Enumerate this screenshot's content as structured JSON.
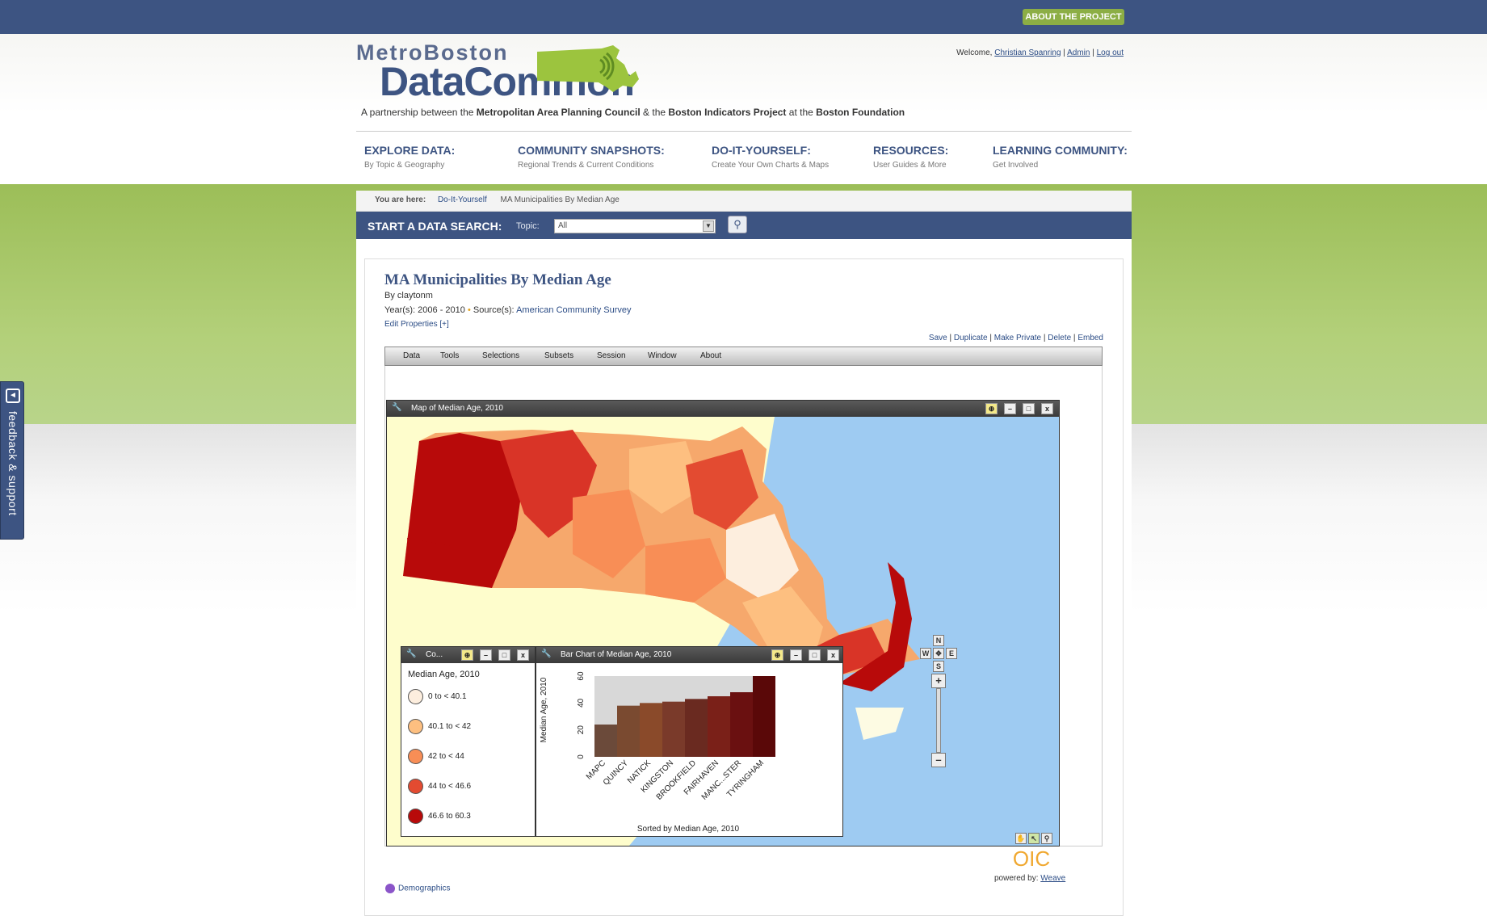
{
  "header": {
    "about_button": "ABOUT THE PROJECT",
    "logo_line1": "MetroBoston",
    "logo_line2": "DataCommon",
    "partnership_prefix": "A partnership between the",
    "partner1": "Metropolitan Area Planning Council",
    "amp": "& the",
    "partner2": "Boston Indicators Project",
    "at_the": "at the",
    "partner3": "Boston Foundation",
    "welcome": "Welcome,",
    "user": "Christian Spanring",
    "admin": "Admin",
    "logout": "Log out"
  },
  "nav": [
    {
      "title": "EXPLORE DATA:",
      "sub": "By Topic & Geography"
    },
    {
      "title": "COMMUNITY SNAPSHOTS:",
      "sub": "Regional Trends & Current Conditions"
    },
    {
      "title": "DO-IT-YOURSELF:",
      "sub": "Create Your Own Charts & Maps"
    },
    {
      "title": "RESOURCES:",
      "sub": "User Guides & More"
    },
    {
      "title": "LEARNING COMMUNITY:",
      "sub": "Get Involved"
    }
  ],
  "breadcrumb": {
    "label": "You are here:",
    "link": "Do-It-Yourself",
    "current": "MA Municipalities By Median Age"
  },
  "search": {
    "label": "START A DATA SEARCH:",
    "topic_label": "Topic:",
    "topic_value": "All"
  },
  "page": {
    "title": "MA Municipalities By Median Age",
    "author": "By claytonm",
    "years_label": "Year(s): 2006 - 2010",
    "sources_label": "Source(s):",
    "source": "American Community Survey",
    "edit": "Edit Properties [+]",
    "actions": [
      "Save",
      "Duplicate",
      "Make Private",
      "Delete",
      "Embed"
    ],
    "menu": [
      "Data",
      "Tools",
      "Selections",
      "Subsets",
      "Session",
      "Window",
      "About"
    ]
  },
  "map_window": {
    "title": "Map of Median Age,  2010"
  },
  "legend_window": {
    "title": "Co...",
    "heading": "Median Age,  2010",
    "items": [
      {
        "label": "0 to  < 40.1",
        "color": "#fdeede"
      },
      {
        "label": "40.1 to  < 42",
        "color": "#fdbf80"
      },
      {
        "label": "42 to  < 44",
        "color": "#f88e56"
      },
      {
        "label": "44 to  < 46.6",
        "color": "#e34b31"
      },
      {
        "label": "46.6 to 60.3",
        "color": "#b80a0a"
      }
    ]
  },
  "bar_window": {
    "title": "Bar Chart of Median Age,  2010"
  },
  "chart_data": {
    "type": "bar",
    "ylabel": "Median Age,  2010",
    "xlabel": "Sorted by Median Age,  2010",
    "ylim": [
      0,
      60
    ],
    "yticks": [
      "0",
      "20",
      "40",
      "60"
    ],
    "categories": [
      "MAPC",
      "QUINCY",
      "NATICK",
      "KINGSTON",
      "BROOKFIELD",
      "FAIRHAVEN",
      "MANC...STER",
      "TYRINGHAM"
    ],
    "values": [
      24,
      38,
      40,
      41,
      43,
      45,
      48,
      60
    ]
  },
  "compass": {
    "n": "N",
    "s": "S",
    "e": "E",
    "w": "W"
  },
  "footer": {
    "powered_by": "powered by:",
    "weave": "Weave",
    "tag": "Demographics",
    "oic": "OIC"
  },
  "feedback": "feedback & support"
}
